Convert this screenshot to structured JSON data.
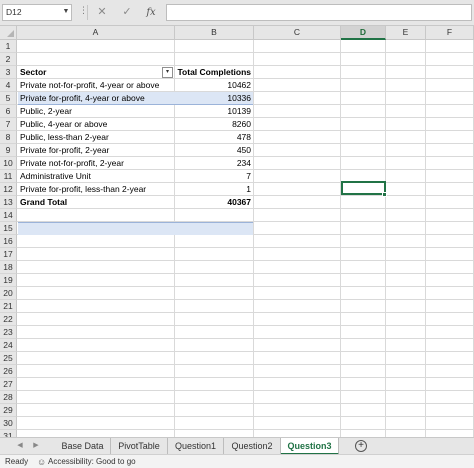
{
  "formula_bar": {
    "name_box": "D12",
    "fx_label": "fx",
    "formula": ""
  },
  "columns": [
    "A",
    "B",
    "C",
    "D",
    "E",
    "F"
  ],
  "selected_column": "D",
  "rows": [
    "1",
    "2",
    "3",
    "4",
    "5",
    "6",
    "7",
    "8",
    "9",
    "10",
    "11",
    "12",
    "13",
    "14",
    "15",
    "16",
    "17",
    "18",
    "19",
    "20",
    "21",
    "22",
    "23",
    "24",
    "25",
    "26",
    "27",
    "28",
    "29",
    "30",
    "31"
  ],
  "pivot": {
    "header_sector": "Sector",
    "header_total": "Total Completions",
    "items": [
      {
        "sector": "Private not-for-profit, 4-year or above",
        "total": "10462"
      },
      {
        "sector": "Private for-profit, 4-year or above",
        "total": "10336"
      },
      {
        "sector": "Public, 2-year",
        "total": "10139"
      },
      {
        "sector": "Public, 4-year or above",
        "total": "8260"
      },
      {
        "sector": "Public, less-than 2-year",
        "total": "478"
      },
      {
        "sector": "Private for-profit, 2-year",
        "total": "450"
      },
      {
        "sector": "Private not-for-profit, 2-year",
        "total": "234"
      },
      {
        "sector": "Administrative Unit",
        "total": "7"
      },
      {
        "sector": "Private for-profit, less-than 2-year",
        "total": "1"
      }
    ],
    "grand_total_label": "Grand Total",
    "grand_total_value": "40367"
  },
  "tabs": [
    {
      "label": "Base Data",
      "active": false
    },
    {
      "label": "PivotTable",
      "active": false
    },
    {
      "label": "Question1",
      "active": false
    },
    {
      "label": "Question2",
      "active": false
    },
    {
      "label": "Question3",
      "active": true
    }
  ],
  "tab_add_symbol": "+",
  "status": {
    "ready": "Ready",
    "accessibility": "Accessibility: Good to go"
  },
  "colors": {
    "accent": "#217346",
    "pivot_header": "#dce6f5"
  }
}
